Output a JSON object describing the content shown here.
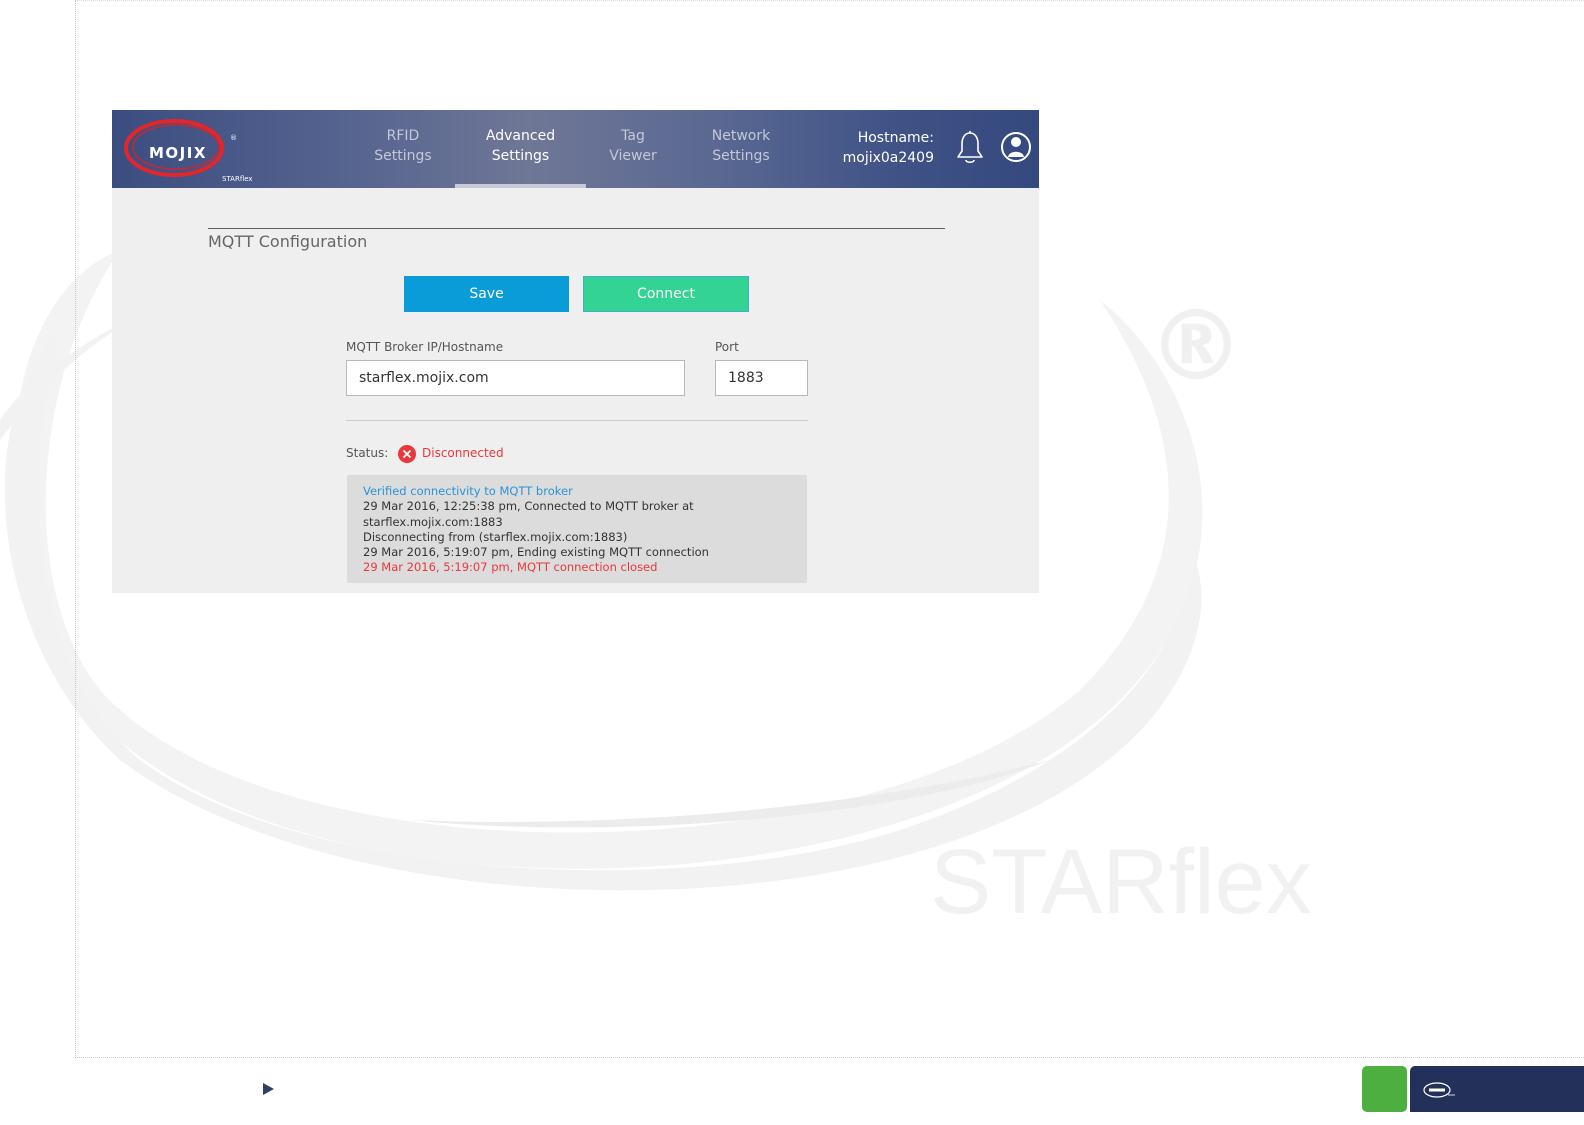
{
  "app": {
    "brand": "MOJIX",
    "brand_sub": "STARflex",
    "brand_reg": "®"
  },
  "nav": {
    "items": [
      {
        "line1": "RFID",
        "line2": "Settings"
      },
      {
        "line1": "Advanced",
        "line2": "Settings",
        "active": true
      },
      {
        "line1": "Tag",
        "line2": "Viewer"
      },
      {
        "line1": "Network",
        "line2": "Settings"
      }
    ],
    "hostname_label": "Hostname:",
    "hostname_value": "mojix0a2409",
    "icons": [
      "bell-icon",
      "user-icon"
    ]
  },
  "section": {
    "title": "MQTT Configuration"
  },
  "actions": {
    "save_label": "Save",
    "connect_label": "Connect"
  },
  "form": {
    "broker_label": "MQTT Broker IP/Hostname",
    "broker_value": "starflex.mojix.com",
    "port_label": "Port",
    "port_value": "1883"
  },
  "status": {
    "label": "Status:",
    "value": "Disconnected"
  },
  "log": {
    "lines": [
      {
        "text": "Verified connectivity to MQTT broker",
        "kind": "info"
      },
      {
        "text": "29 Mar 2016, 12:25:38 pm, Connected to MQTT broker at",
        "kind": "normal"
      },
      {
        "text": "starflex.mojix.com:1883",
        "kind": "normal"
      },
      {
        "text": "Disconnecting from (starflex.mojix.com:1883)",
        "kind": "normal"
      },
      {
        "text": "29 Mar 2016, 5:19:07 pm, Ending existing MQTT connection",
        "kind": "normal"
      },
      {
        "text": "29 Mar 2016, 5:19:07 pm, MQTT connection closed",
        "kind": "err"
      }
    ]
  },
  "watermark": {
    "reg": "®",
    "text": "STARflex"
  },
  "colors": {
    "save": "#0a9bd9",
    "connect": "#33d393",
    "error": "#e8383b",
    "info": "#2b93d5",
    "nav_dark": "#34497e"
  }
}
